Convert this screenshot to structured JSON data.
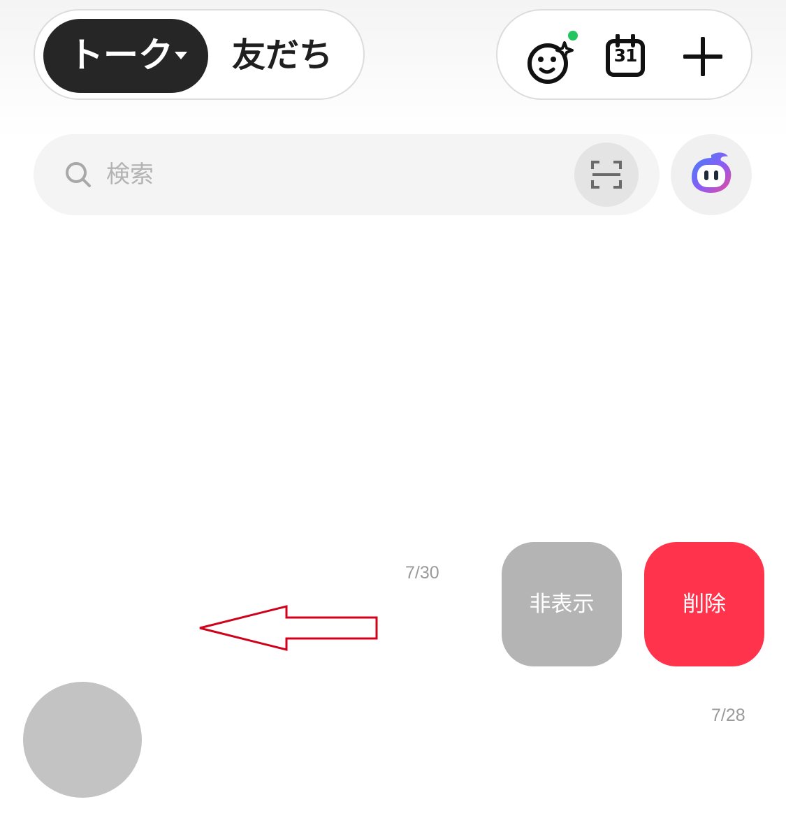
{
  "header": {
    "tabs": [
      {
        "label": "トーク",
        "active": true,
        "has_dropdown": true
      },
      {
        "label": "友だち",
        "active": false
      }
    ],
    "actions": [
      {
        "icon": "sticker-sparkle-icon",
        "badge_color": "#22c55e"
      },
      {
        "icon": "calendar-icon",
        "day_label": "31"
      },
      {
        "icon": "plus-icon"
      }
    ]
  },
  "search": {
    "placeholder": "検索",
    "scan_icon": "scan-frame-icon",
    "ai_icon": "ai-assistant-icon"
  },
  "chat_rows": [
    {
      "date": "7/30",
      "swipe_actions": [
        {
          "label": "非表示",
          "color": "#b4b4b4"
        },
        {
          "label": "削除",
          "color": "#ff334b"
        }
      ]
    },
    {
      "date": "7/28"
    }
  ],
  "annotation": {
    "icon": "left-arrow-icon",
    "color": "#d0021b"
  },
  "colors": {
    "accent_dark": "#262626",
    "delete_red": "#ff334b",
    "online_green": "#22c55e"
  }
}
